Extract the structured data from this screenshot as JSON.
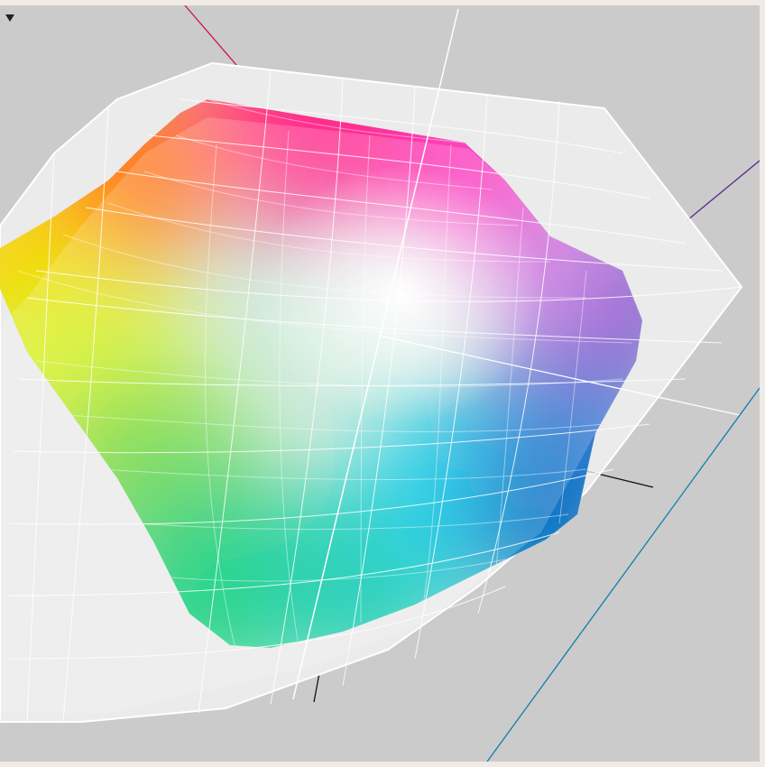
{
  "viewer": {
    "menu_icon": "triangle-down-icon",
    "background_color": "#cbcbcb",
    "frame_color": "#f0ebe6"
  },
  "axes": {
    "colors": [
      "#d0104c",
      "#5b2a90",
      "#0e7eb0",
      "#ffffff",
      "#111111"
    ]
  },
  "gamuts": [
    {
      "kind": "solid",
      "palette": [
        "#ff2f8e",
        "#ff7b24",
        "#ffe600",
        "#7fd63a",
        "#00cc6e",
        "#00c8e0",
        "#1a78d2",
        "#7040c8",
        "#ffffff"
      ]
    },
    {
      "kind": "wireframe",
      "fill": "#f2f2f2",
      "stroke": "#ffffff"
    }
  ]
}
